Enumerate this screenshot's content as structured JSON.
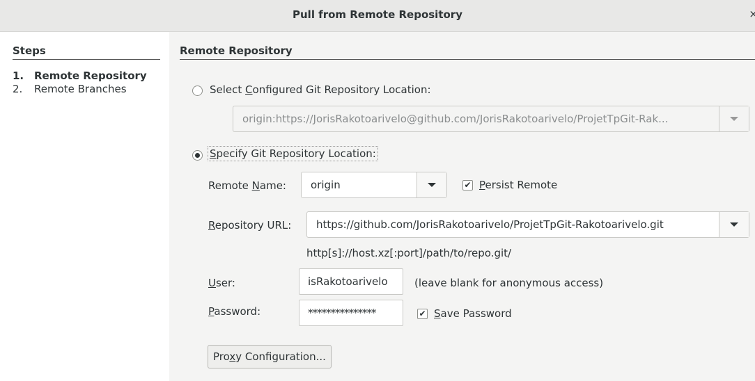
{
  "window": {
    "title": "Pull from Remote Repository",
    "close_glyph": "×"
  },
  "steps": {
    "header": "Steps",
    "items": [
      {
        "num": "1.",
        "label": "Remote Repository",
        "active": true
      },
      {
        "num": "2.",
        "label": "Remote Branches",
        "active": false
      }
    ]
  },
  "panel": {
    "header": "Remote Repository",
    "configured": {
      "label_pre": "Select ",
      "label_mn": "C",
      "label_post": "onfigured Git Repository Location:",
      "selected": false,
      "combo_value": "origin:https://JorisRakotoarivelo@github.com/JorisRakotoarivelo/ProjetTpGit-Rak..."
    },
    "specify": {
      "label_mn": "S",
      "label_post": "pecify Git Repository Location:",
      "selected": true
    },
    "remote_name": {
      "label_pre": "Remote ",
      "label_mn": "N",
      "label_post": "ame:",
      "value": "origin"
    },
    "persist_remote": {
      "checked": true,
      "label_mn": "P",
      "label_post": "ersist Remote"
    },
    "repository_url": {
      "label_mn": "R",
      "label_post": "epository URL:",
      "value": "https://github.com/JorisRakotoarivelo/ProjetTpGit-Rakotoarivelo.git",
      "hint": "http[s]://host.xz[:port]/path/to/repo.git/"
    },
    "user": {
      "label_mn": "U",
      "label_post": "ser:",
      "value": "isRakotoarivelo",
      "hint": "(leave blank for anonymous access)"
    },
    "password": {
      "label_mn": "P",
      "label_post": "assword:",
      "masked_value": "***************"
    },
    "save_password": {
      "checked": true,
      "label_mn": "S",
      "label_post": "ave Password"
    },
    "proxy_button": {
      "label_pre": "Pro",
      "label_mn": "x",
      "label_post": "y Configuration..."
    },
    "check_glyph": "✔"
  }
}
